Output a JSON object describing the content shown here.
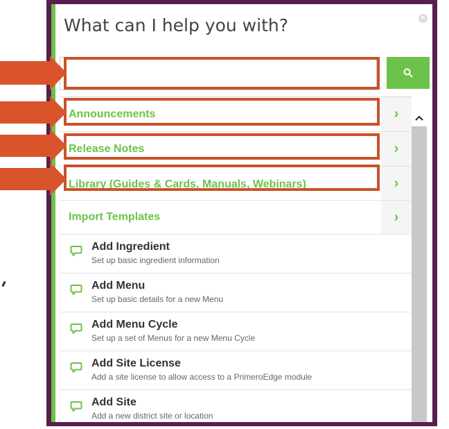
{
  "title": "What can I help you with?",
  "search": {
    "value": "",
    "placeholder": ""
  },
  "sections": [
    {
      "label": "Announcements",
      "arrow": "›"
    },
    {
      "label": "Release Notes",
      "arrow": "›"
    },
    {
      "label": "Library (Guides & Cards, Manuals, Webinars)",
      "arrow": "›"
    },
    {
      "label": "Import Templates",
      "arrow": "›"
    }
  ],
  "items": [
    {
      "title": "Add Ingredient",
      "subtitle": "Set up basic ingredient information"
    },
    {
      "title": "Add Menu",
      "subtitle": "Set up basic details for a new Menu"
    },
    {
      "title": "Add Menu Cycle",
      "subtitle": "Set up a set of Menus for a new Menu Cycle"
    },
    {
      "title": "Add Site License",
      "subtitle": "Add a site license to allow access to a PrimeroEdge module"
    },
    {
      "title": "Add Site",
      "subtitle": "Add a new district site or location"
    }
  ],
  "colors": {
    "accent": "#6cc24a",
    "frame": "#5a1e4e",
    "highlight": "#c8522a",
    "callout": "#d9542b"
  },
  "icons": {
    "close": "close-icon",
    "search": "search-icon",
    "item": "chat-bubble-icon",
    "scroll_up": "chevron-up-icon"
  }
}
